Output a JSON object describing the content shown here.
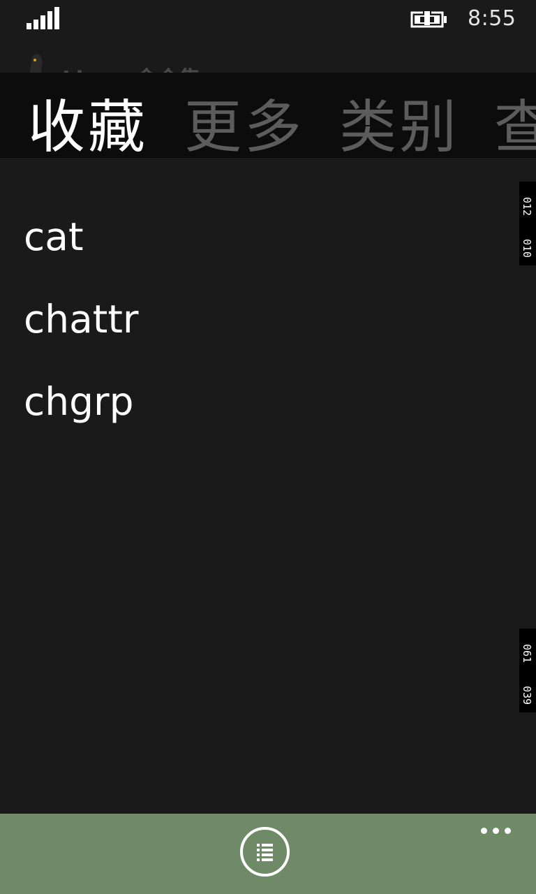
{
  "status_bar": {
    "time": "8:55",
    "signal_icon": "signal-bars-icon",
    "battery_icon": "battery-charging-icon"
  },
  "header": {
    "app_title": "Linux 命令集",
    "logo_icon": "penguin-icon"
  },
  "pivot": {
    "tabs": [
      {
        "label": "收藏",
        "active": true
      },
      {
        "label": "更多",
        "active": false
      },
      {
        "label": "类别",
        "active": false
      },
      {
        "label": "查",
        "active": false
      }
    ]
  },
  "favorites": {
    "items": [
      "cat",
      "chattr",
      "chgrp"
    ]
  },
  "side_tags": [
    {
      "top": "012",
      "bottom": "010"
    },
    {
      "top": "061",
      "bottom": "039"
    }
  ],
  "app_bar": {
    "list_button_icon": "list-icon",
    "more_icon": "ellipsis-icon"
  },
  "colors": {
    "background": "#1a1a1a",
    "pivot_background": "#0c0c0c",
    "app_bar": "#6e8a66",
    "inactive_tab": "#5c5c5c"
  }
}
